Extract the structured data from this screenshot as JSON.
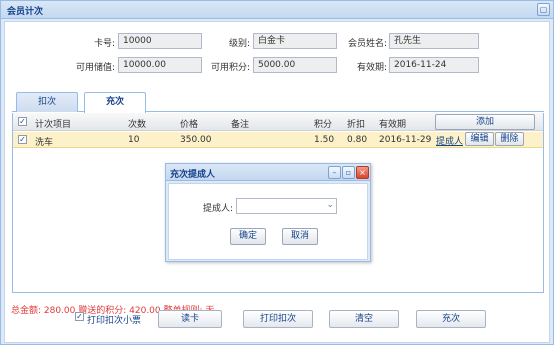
{
  "window": {
    "title": "会员计次"
  },
  "member": {
    "card_label": "卡号:",
    "card_value": "10000",
    "level_label": "级别:",
    "level_value": "白金卡",
    "name_label": "会员姓名:",
    "name_value": "孔先生",
    "balance_label": "可用储值:",
    "balance_value": "10000.00",
    "points_label": "可用积分:",
    "points_value": "5000.00",
    "expiry_label": "有效期:",
    "expiry_value": "2016-11-24"
  },
  "tabs": [
    {
      "label": "扣次"
    },
    {
      "label": "充次"
    }
  ],
  "grid": {
    "headers": [
      "计次项目",
      "次数",
      "价格",
      "备注",
      "积分",
      "折扣",
      "有效期"
    ],
    "add_label": "添加",
    "rows": [
      {
        "item": "洗车",
        "count": "10",
        "price": "350.00",
        "note": "",
        "points": "1.50",
        "discount": "0.80",
        "expiry": "2016-11-29",
        "agent_link": "提成人",
        "edit_label": "编辑",
        "delete_label": "删除"
      }
    ]
  },
  "summary": {
    "text": "总金额: 280.00 赠送的积分: 420.00 整单规则: 无"
  },
  "footer": {
    "print_label": "打印扣次小票",
    "read_card_label": "读卡",
    "print_deduct_label": "打印扣次",
    "clear_label": "清空",
    "recharge_label": "充次"
  },
  "dialog": {
    "title": "充次提成人",
    "agent_label": "提成人:",
    "agent_value": "",
    "ok_label": "确定",
    "cancel_label": "取消"
  },
  "icons": {
    "window_restore": "restore-icon",
    "dialog_min": "minimize-icon",
    "dialog_max": "maximize-icon",
    "dialog_close": "close-icon",
    "combo_arrow": "chevron-down-icon"
  }
}
